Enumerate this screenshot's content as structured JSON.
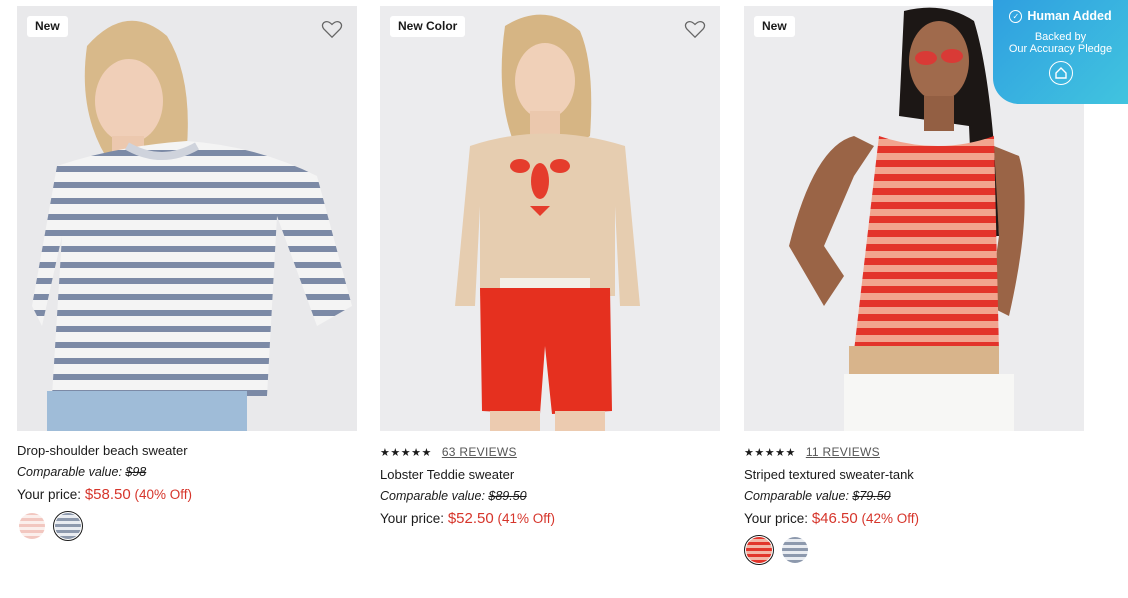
{
  "products": [
    {
      "badge": "New",
      "name": "Drop-shoulder beach sweater",
      "comparable_label": "Comparable value:",
      "comparable_price": "$98",
      "your_price_label": "Your price:",
      "price": "$58.50",
      "discount": "(40% Off)",
      "swatches": [
        {
          "name": "pink stripe",
          "color": "#f2c7c0",
          "selected": false
        },
        {
          "name": "navy stripe",
          "color": "#8d99ad",
          "selected": true
        }
      ]
    },
    {
      "badge": "New Color",
      "stars": "★★★★★",
      "reviews": "63 REVIEWS",
      "name": "Lobster Teddie sweater",
      "comparable_label": "Comparable value:",
      "comparable_price": "$89.50",
      "your_price_label": "Your price:",
      "price": "$52.50",
      "discount": "(41% Off)"
    },
    {
      "badge": "New",
      "stars": "★★★★★",
      "reviews": "11 REVIEWS",
      "name": "Striped textured sweater-tank",
      "comparable_label": "Comparable value:",
      "comparable_price": "$79.50",
      "your_price_label": "Your price:",
      "price": "$46.50",
      "discount": "(42% Off)",
      "swatches": [
        {
          "name": "red stripe",
          "color": "#e2352b",
          "selected": true
        },
        {
          "name": "blue stripe",
          "color": "#8d99ad",
          "selected": false
        }
      ]
    }
  ],
  "pledge": {
    "title": "Human Added",
    "line1": "Backed by",
    "line2": "Our Accuracy Pledge"
  },
  "colors": {
    "sale_red": "#d6352b",
    "pledge_blue": "#2f9fe0"
  }
}
